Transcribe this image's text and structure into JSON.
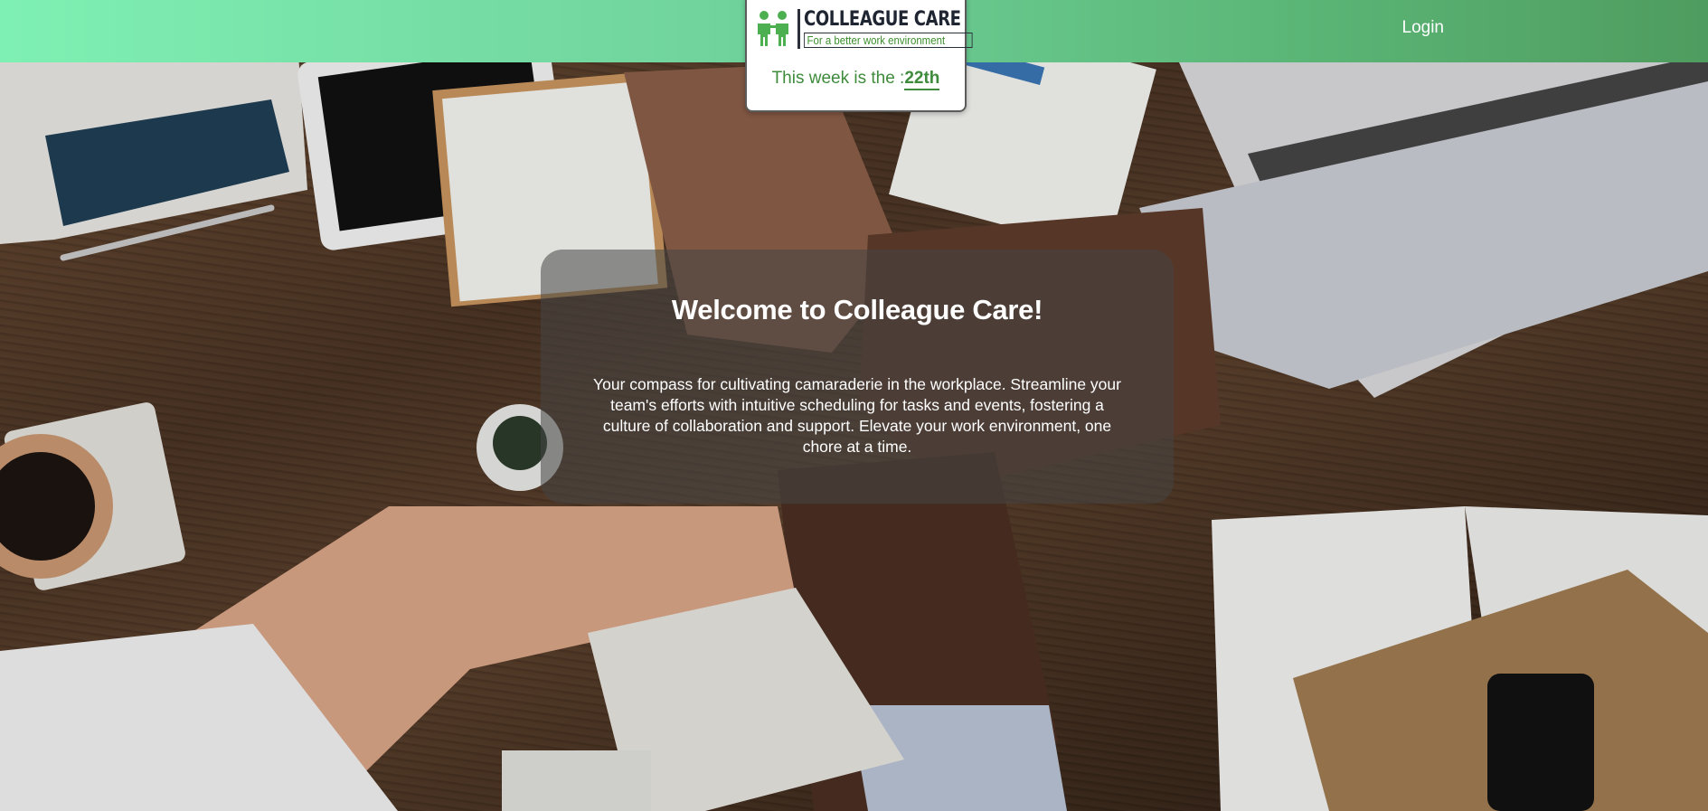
{
  "header": {
    "login_label": "Login",
    "gradient_start": "#7ff0b3",
    "gradient_end": "#4f9c5f"
  },
  "logo": {
    "icon": "two-people-holding-hands-icon",
    "name": "COLLEAGUE CARE",
    "tagline": "For a better work environment"
  },
  "week": {
    "label": "This week is the :",
    "value": "22th"
  },
  "hero": {
    "title": "Welcome to Colleague Care!",
    "description": "Your compass for cultivating camaraderie in the workplace. Streamline your team's efforts with intuitive scheduling for tasks and events, fostering a culture of collaboration and support. Elevate your work environment, one chore at a time."
  },
  "background": {
    "scene": "team-fist-bump-over-desk-photo"
  },
  "colors": {
    "accent_green": "#3f8b3c",
    "logo_dark": "#1f2632"
  }
}
